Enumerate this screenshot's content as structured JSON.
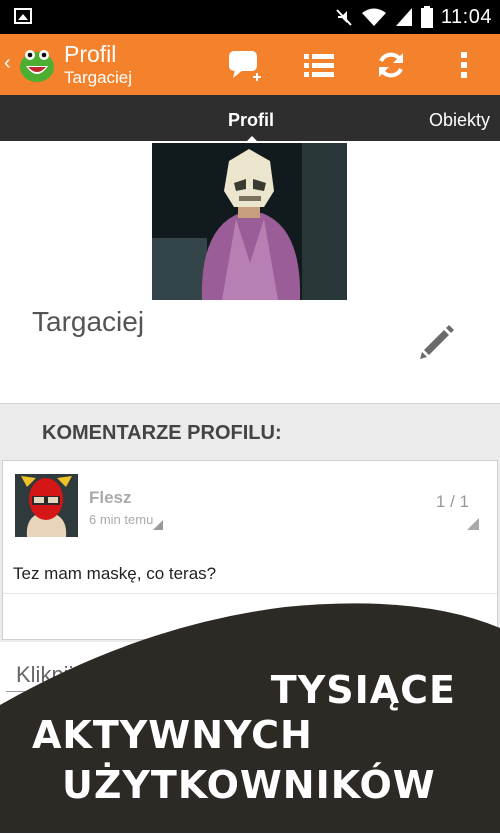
{
  "statusbar": {
    "time": "11:04",
    "icons": [
      "image-icon",
      "mute-icon",
      "wifi-icon",
      "signal-icon",
      "battery-icon"
    ]
  },
  "actionbar": {
    "title": "Profil",
    "subtitle": "Targaciej",
    "back_icon": "chevron-left-icon",
    "logo": "green-monster-logo",
    "actions": [
      "new-comment-icon",
      "list-icon",
      "refresh-icon",
      "overflow-menu-icon"
    ],
    "color": "#f4812c"
  },
  "tabs": [
    {
      "label": "Profil",
      "active": true
    },
    {
      "label": "Obiekty",
      "active": false
    }
  ],
  "profile": {
    "username": "Targaciej"
  },
  "comments": {
    "header": "KOMENTARZE PROFILU:",
    "items": [
      {
        "author": "Flesz",
        "time": "6 min temu",
        "page": "1 / 1",
        "text": "Tez mam maskę, co teras?"
      }
    ]
  },
  "comment_input": {
    "placeholder": "Kliknij"
  },
  "promo": {
    "line1": "TYSIĄCE",
    "line2": "AKTYWNYCH",
    "line3": "UŻYTKOWNIKÓW",
    "background": "#2d2925"
  }
}
